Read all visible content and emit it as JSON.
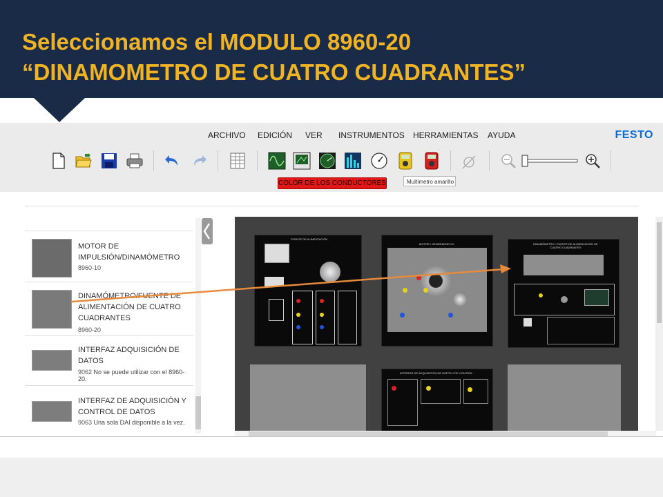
{
  "slide": {
    "title_line1": "Seleccionamos el MODULO 8960-20",
    "title_line2": "“DINAMOMETRO DE CUATRO CUADRANTES”"
  },
  "menu": {
    "items": [
      "ARCHIVO",
      "EDICIÓN",
      "VER",
      "INSTRUMENTOS",
      "HERRAMIENTAS",
      "AYUDA"
    ],
    "brand": "FESTO"
  },
  "toolbar": {
    "icons": [
      "new-file-icon",
      "open-folder-icon",
      "save-icon",
      "print-icon",
      "undo-icon",
      "redo-icon",
      "table-icon",
      "oscilloscope-icon",
      "phasor-analyzer-icon",
      "power-meter-icon",
      "harmonic-analyzer-icon",
      "speed-meter-icon",
      "yellow-multimeter-icon",
      "red-multimeter-icon",
      "probe-icon",
      "zoom-out-icon",
      "zoom-slider",
      "zoom-in-icon"
    ],
    "conductor_color_label": "COLOR DE LOS CONDUCTORES",
    "multimeter_select": "Multímetro amarillo"
  },
  "module_list": [
    {
      "title": "MOTOR DE IMPULSIÓN/DINAMÓMETRO",
      "code": "8960-10",
      "note": ""
    },
    {
      "title": "DINAMÓMETRO/FUENTE DE ALIMENTACIÓN DE CUATRO CUADRANTES",
      "code": "8960-20",
      "note": ""
    },
    {
      "title": "INTERFAZ ADQUISICIÓN DE DATOS",
      "code": "9062",
      "note": "No se puede utilizar con el 8960-20."
    },
    {
      "title": "INTERFAZ DE ADQUISICIÓN Y CONTROL DE DATOS",
      "code": "9063",
      "note": "Una sola DAI disponible a la vez."
    }
  ],
  "workspace": {
    "panels": [
      {
        "title": "FUENTE DE ALIMENTACIÓN"
      },
      {
        "title": "MOTOR / GENERADOR CC"
      },
      {
        "title": "DINAMÓMETRO / FUENTE DE ALIMENTACIÓN DE CUATRO CUADRANTES"
      },
      {
        "title": "INTERFAZ DE ADQUISICIÓN DE DATOS Y DE CONTROL"
      }
    ]
  },
  "colors": {
    "banner_bg": "#1a2b47",
    "title_text": "#f0b323",
    "arrow": "#e88a3a",
    "brand": "#0a6ad6",
    "conductor_button": "#e01818"
  }
}
